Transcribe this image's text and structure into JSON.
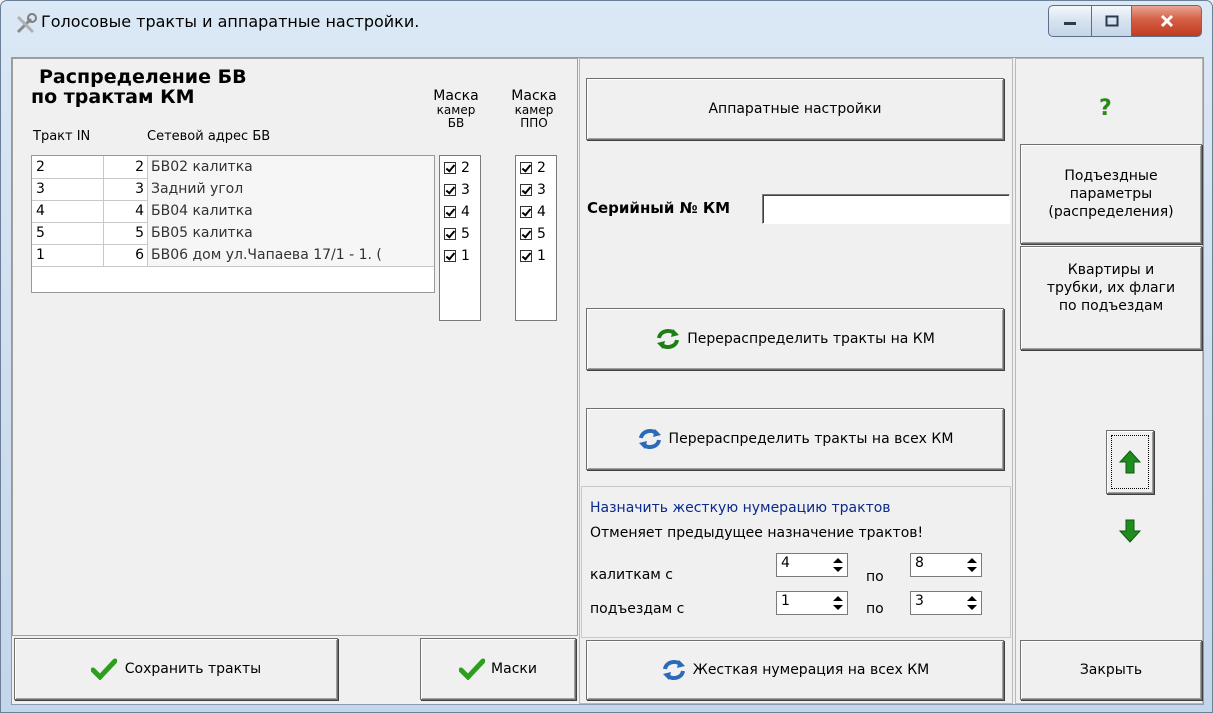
{
  "window": {
    "title": "Голосовые тракты и аппаратные настройки."
  },
  "left": {
    "heading_line1": "Распределение БВ",
    "heading_line2": "по трактам КМ",
    "col_trakt_in": "Тракт IN",
    "col_address": "Сетевой адрес БВ",
    "mask_bv_header": [
      "Маска",
      "камер",
      "БВ"
    ],
    "mask_ppo_header": [
      "Маска",
      "камер",
      "ППО"
    ],
    "rows": [
      {
        "trakt": "2",
        "num": "2",
        "address": "БВ02 калитка",
        "mask_bv": "2",
        "mask_ppo": "2"
      },
      {
        "trakt": "3",
        "num": "3",
        "address": "Задний угол",
        "mask_bv": "3",
        "mask_ppo": "3"
      },
      {
        "trakt": "4",
        "num": "4",
        "address": "БВ04 калитка",
        "mask_bv": "4",
        "mask_ppo": "4"
      },
      {
        "trakt": "5",
        "num": "5",
        "address": "БВ05 калитка",
        "mask_bv": "5",
        "mask_ppo": "5"
      },
      {
        "trakt": "1",
        "num": "6",
        "address": "БВ06 дом ул.Чапаева 17/1 - 1. (",
        "mask_bv": "1",
        "mask_ppo": "1"
      }
    ],
    "save_button": "Сохранить тракты",
    "masks_button": "Маски"
  },
  "middle": {
    "hw_settings_button": "Аппаратные настройки",
    "serial_label": "Серийный № КМ",
    "serial_value": "",
    "redistribute_button": "Перераспределить тракты на КМ",
    "redistribute_all_button": "Перераспределить тракты на всех КМ",
    "hard_numbering_title": "Назначить жесткую нумерацию трактов",
    "hard_numbering_note": "Отменяет предыдущее назначение трактов!",
    "gates_label": "калиткам  с",
    "entrances_label": "подъездам с",
    "to_label": "по",
    "gates_from": "4",
    "gates_to": "8",
    "entrances_from": "1",
    "entrances_to": "3",
    "hard_numbering_button": "Жесткая нумерация на всех КМ"
  },
  "right": {
    "help_label": "?",
    "entrance_params_button": [
      "Подъездные",
      "параметры",
      "(распределения)"
    ],
    "apartments_button": [
      "Квартиры и",
      "трубки, их флаги",
      "по подъездам"
    ],
    "close_button": "Закрыть"
  },
  "colors": {
    "accent_green": "#2e9e1f",
    "link_blue": "#0b2a8a",
    "help_green": "#2a8a17"
  }
}
